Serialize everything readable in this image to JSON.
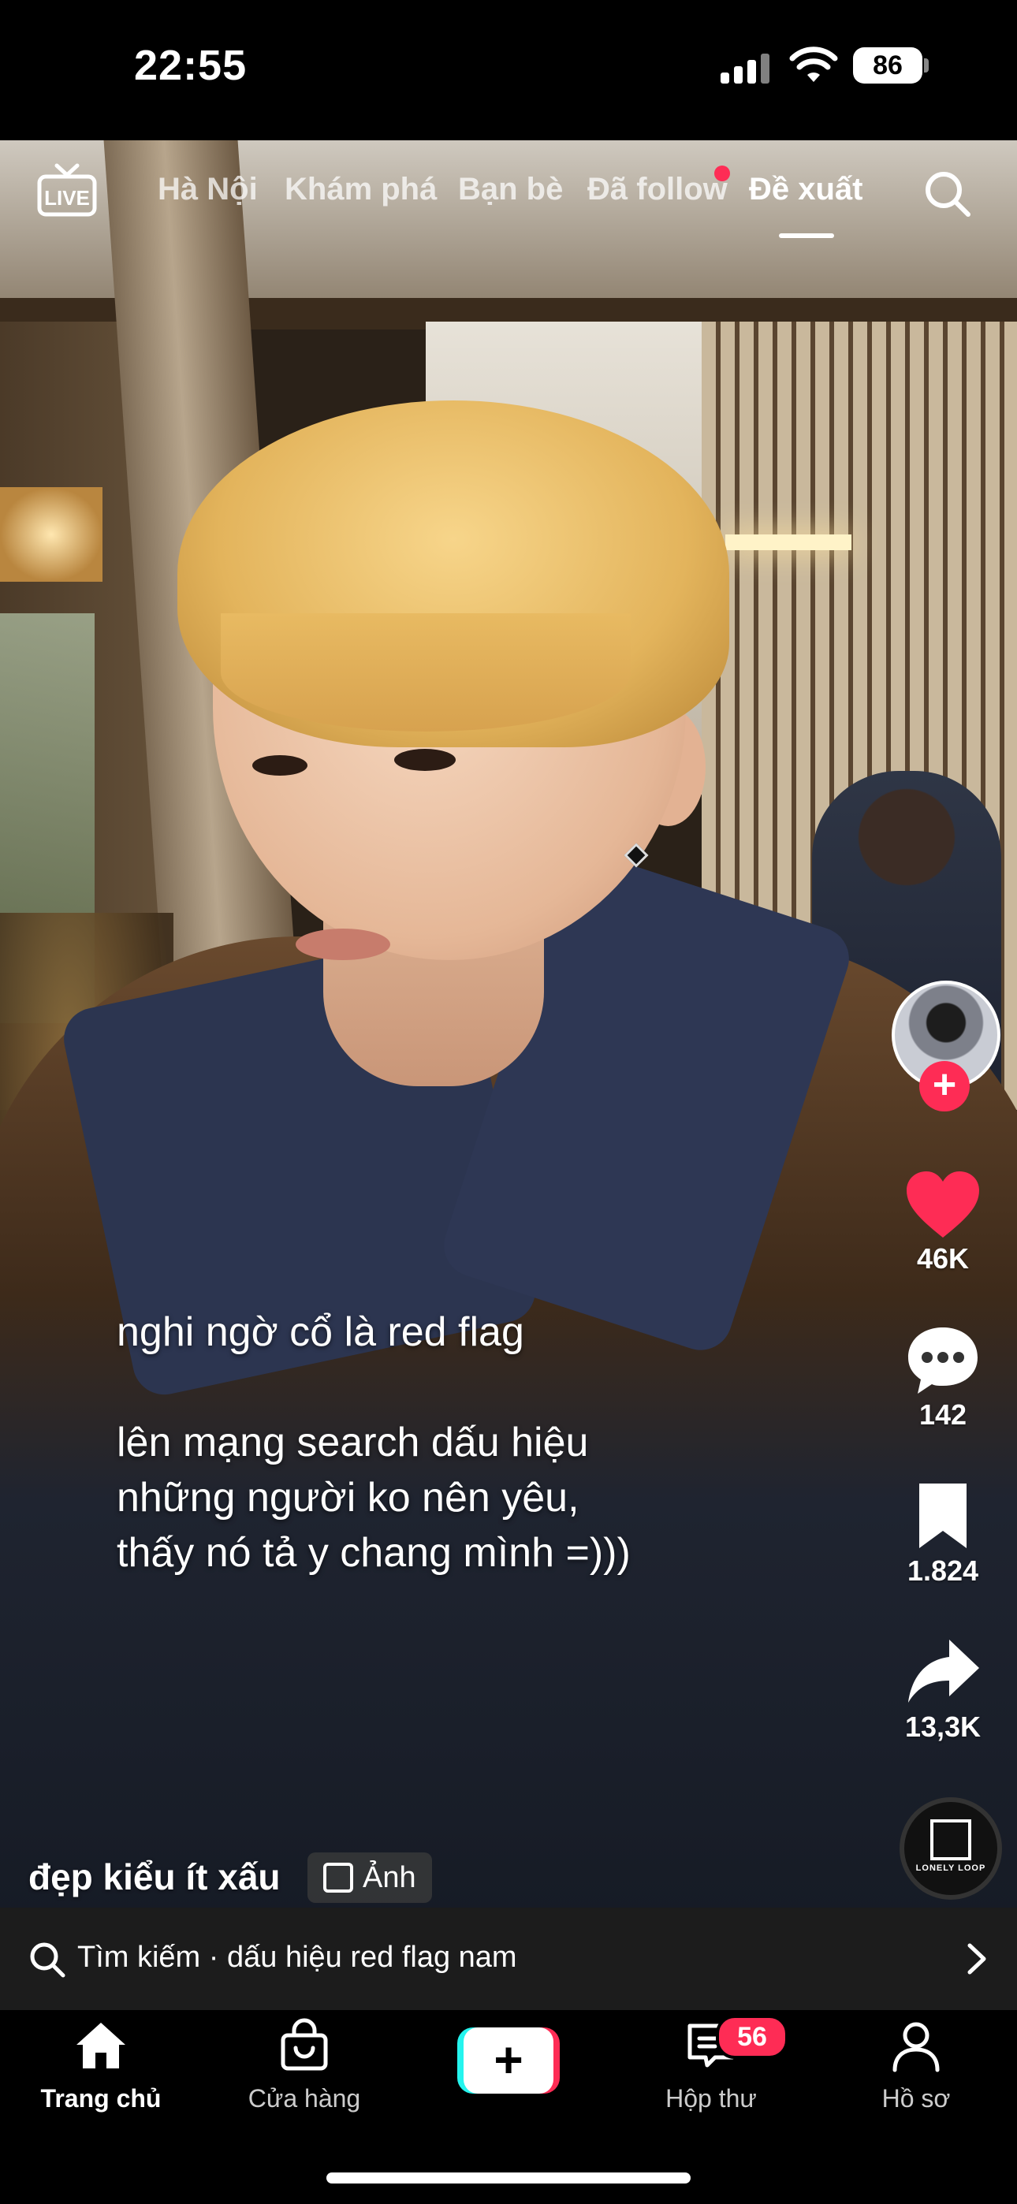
{
  "status_bar": {
    "time": "22:55",
    "battery": "86"
  },
  "top_nav": {
    "live_label": "LIVE",
    "tabs": [
      {
        "label": "Hà Nội",
        "active": false
      },
      {
        "label": "Khám phá",
        "active": false
      },
      {
        "label": "Bạn bè",
        "active": false
      },
      {
        "label": "Đã follow",
        "active": false,
        "notification_dot": true
      },
      {
        "label": "Đề xuất",
        "active": true
      }
    ]
  },
  "post": {
    "caption_lines": [
      "nghi ngờ cổ là red flag",
      "lên mạng search dấu hiệu",
      "những người ko nên yêu,",
      "thấy nó tả y chang mình =)))"
    ],
    "author": "đẹp kiểu ít xấu",
    "media_tag": "Ảnh",
    "likes": "46K",
    "comments": "142",
    "saves": "1.824",
    "shares": "13,3K",
    "music_brand": "LONELY LOOP"
  },
  "search_suggestion": {
    "text": "Tìm kiếm · dấu hiệu red flag nam"
  },
  "tab_bar": {
    "home": "Trang chủ",
    "shop": "Cửa hàng",
    "create": "+",
    "inbox": "Hộp thư",
    "inbox_badge": "56",
    "profile": "Hồ sơ"
  },
  "colors": {
    "accent": "#fe2c55",
    "cyan": "#25f4ee"
  },
  "icons": [
    "live-tv-icon",
    "search-icon",
    "heart-icon",
    "comment-icon",
    "bookmark-icon",
    "share-icon",
    "home-icon",
    "shop-bag-icon",
    "inbox-icon",
    "profile-icon",
    "photo-icon",
    "chevron-right-icon"
  ]
}
